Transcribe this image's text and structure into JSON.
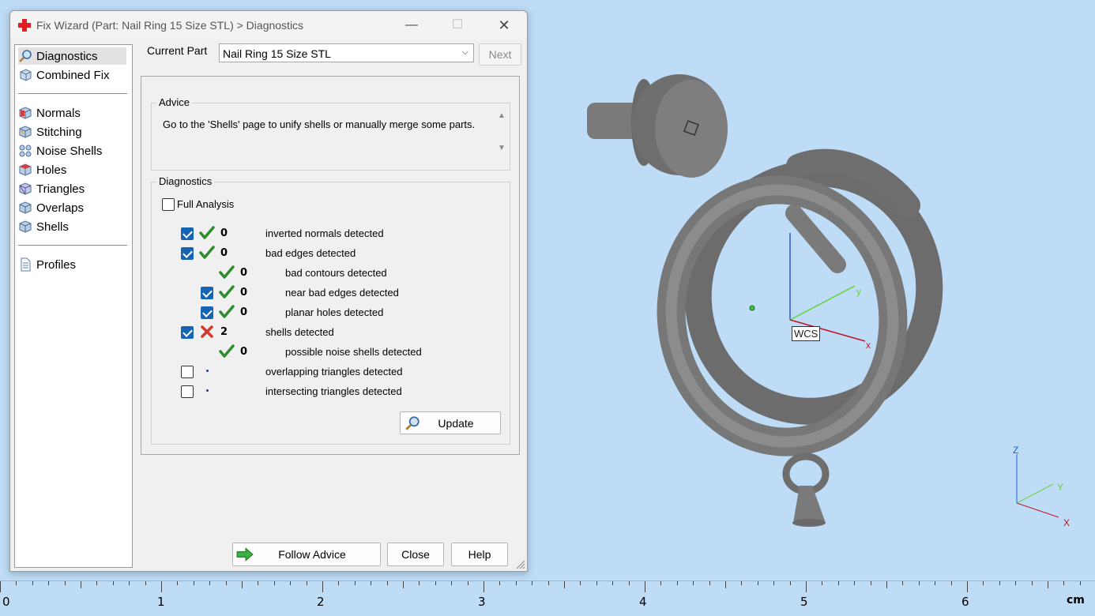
{
  "dialog": {
    "title": "Fix Wizard (Part: Nail Ring 15 Size STL) > Diagnostics",
    "controls": {
      "minimize": "—",
      "maximize": "☐",
      "close": "✕"
    }
  },
  "nav": {
    "items": [
      {
        "label": "Diagnostics",
        "icon": "magnifier-icon",
        "selected": true
      },
      {
        "label": "Combined Fix",
        "icon": "cube-stack-icon"
      },
      {
        "label": "Normals",
        "icon": "normals-cube-icon"
      },
      {
        "label": "Stitching",
        "icon": "stitching-cube-icon"
      },
      {
        "label": "Noise Shells",
        "icon": "noise-shells-icon"
      },
      {
        "label": "Holes",
        "icon": "holes-cube-icon"
      },
      {
        "label": "Triangles",
        "icon": "triangles-cube-icon"
      },
      {
        "label": "Overlaps",
        "icon": "overlaps-cube-icon"
      },
      {
        "label": "Shells",
        "icon": "shells-cube-icon"
      },
      {
        "label": "Profiles",
        "icon": "document-icon"
      }
    ]
  },
  "current_part": {
    "label": "Current Part",
    "value": "Nail Ring 15 Size STL",
    "next_label": "Next"
  },
  "advice": {
    "title": "Advice",
    "text": "Go to the 'Shells' page to unify shells or manually merge some parts."
  },
  "diagnostics": {
    "title": "Diagnostics",
    "full_analysis_label": "Full Analysis",
    "full_analysis_checked": false,
    "rows": [
      {
        "checkbox": "checked",
        "status": "ok",
        "count": "0",
        "label": "inverted normals detected",
        "indent": 0
      },
      {
        "checkbox": "checked",
        "status": "ok",
        "count": "0",
        "label": "bad edges detected",
        "indent": 0
      },
      {
        "checkbox": "none",
        "status": "ok",
        "count": "0",
        "label": "bad contours detected",
        "indent": 1
      },
      {
        "checkbox": "checked",
        "status": "ok",
        "count": "0",
        "label": "near bad edges detected",
        "indent": 1
      },
      {
        "checkbox": "checked",
        "status": "ok",
        "count": "0",
        "label": "planar holes detected",
        "indent": 1
      },
      {
        "checkbox": "checked",
        "status": "error",
        "count": "2",
        "label": "shells detected",
        "indent": 0
      },
      {
        "checkbox": "none",
        "status": "ok",
        "count": "0",
        "label": "possible noise shells detected",
        "indent": 1
      },
      {
        "checkbox": "unchecked",
        "status": "pending",
        "count": "",
        "label": "overlapping triangles detected",
        "indent": 0
      },
      {
        "checkbox": "unchecked",
        "status": "pending",
        "count": "",
        "label": "intersecting triangles detected",
        "indent": 0
      }
    ],
    "update_label": "Update"
  },
  "footer": {
    "follow_advice": "Follow Advice",
    "close": "Close",
    "help": "Help"
  },
  "viewport": {
    "wcs_label": "WCS",
    "wcs_axes": {
      "x": "x",
      "y": "y"
    },
    "corner_axes": {
      "x": "X",
      "y": "Y",
      "z": "Z"
    },
    "colors": {
      "background": "#bedcf5",
      "x_axis": "#c0142a",
      "y_axis": "#5fd63a",
      "z_axis": "#2a5ad6",
      "model": "#8a8a8a"
    }
  },
  "ruler": {
    "labels": [
      "0",
      "1",
      "2",
      "3",
      "4",
      "5",
      "6"
    ],
    "unit": "cm"
  }
}
